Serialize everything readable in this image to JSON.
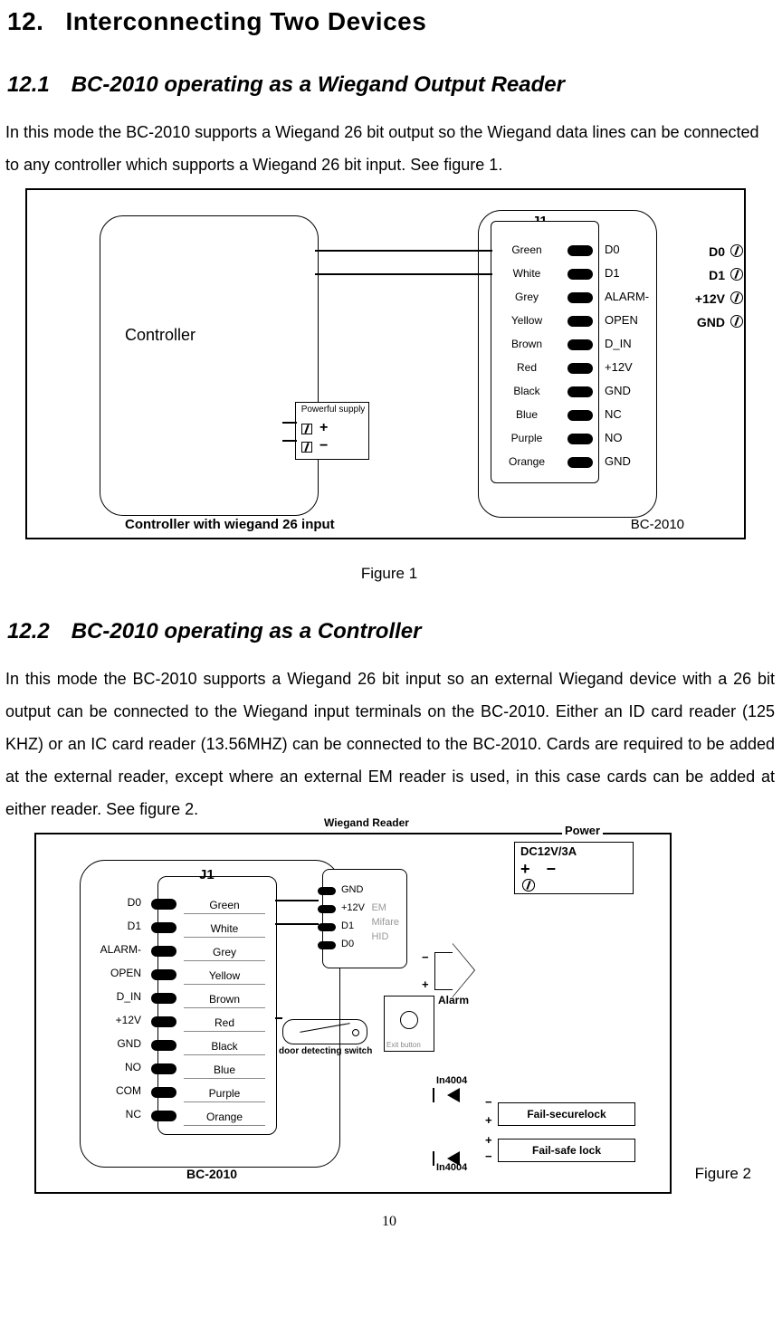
{
  "page": {
    "number": "10"
  },
  "h1": {
    "num": "12.",
    "title": "Interconnecting Two Devices"
  },
  "section1": {
    "num": "12.1",
    "title": "BC-2010 operating as a Wiegand Output Reader",
    "body": "In this mode the BC-2010 supports a Wiegand 26 bit output so the Wiegand data lines can be connected to any controller which supports a Wiegand 26 bit input. See figure 1.",
    "caption": "Figure 1"
  },
  "section2": {
    "num": "12.2",
    "title": "BC-2010 operating as a Controller",
    "body": "In this mode the BC-2010 supports a Wiegand 26 bit input so an external Wiegand device with a 26 bit output can be connected to the Wiegand input terminals on the BC-2010. Either an ID card reader (125 KHZ) or an IC card reader (13.56MHZ) can be connected to the BC-2010. Cards are required to be added at the external reader, except where an external EM reader is used, in this case cards can be added at either reader. See figure 2.",
    "caption": "Figure 2"
  },
  "fig1": {
    "controller_label": "Controller",
    "controller_caption": "Controller with wiegand 26 input",
    "bc_label": "BC-2010",
    "j1_label": "J1",
    "psu_label": "Powerful supply",
    "controller_terms": [
      "D0",
      "D1",
      "+12V",
      "GND"
    ],
    "j1_rows": [
      {
        "color": "Green",
        "pin": "D0"
      },
      {
        "color": "White",
        "pin": "D1"
      },
      {
        "color": "Grey",
        "pin": "ALARM-"
      },
      {
        "color": "Yellow",
        "pin": "OPEN"
      },
      {
        "color": "Brown",
        "pin": "D_IN"
      },
      {
        "color": "Red",
        "pin": "+12V"
      },
      {
        "color": "Black",
        "pin": "GND"
      },
      {
        "color": "Blue",
        "pin": "NC"
      },
      {
        "color": "Purple",
        "pin": "NO"
      },
      {
        "color": "Orange",
        "pin": "GND"
      }
    ]
  },
  "fig2": {
    "bc_label": "BC-2010",
    "j1_label": "J1",
    "left_labels": [
      "D0",
      "D1",
      "ALARM-",
      "OPEN",
      "D_IN",
      "+12V",
      "GND",
      "NO",
      "COM",
      "NC"
    ],
    "j1_colors": [
      "Green",
      "White",
      "Grey",
      "Yellow",
      "Brown",
      "Red",
      "Black",
      "Blue",
      "Purple",
      "Orange"
    ],
    "wiegand_reader": {
      "title": "Wiegand Reader",
      "pins": [
        "GND",
        "+12V",
        "D1",
        "D0"
      ],
      "types": [
        "EM",
        "Mifare",
        "HID"
      ]
    },
    "power": {
      "title": "Power",
      "text": "DC12V/3A"
    },
    "alarm": "Alarm",
    "exit_label": "Exit button",
    "doorsw_label": "door detecting switch",
    "lock1": "Fail-securelock",
    "lock2": "Fail-safe lock",
    "diode_label": "In4004"
  }
}
